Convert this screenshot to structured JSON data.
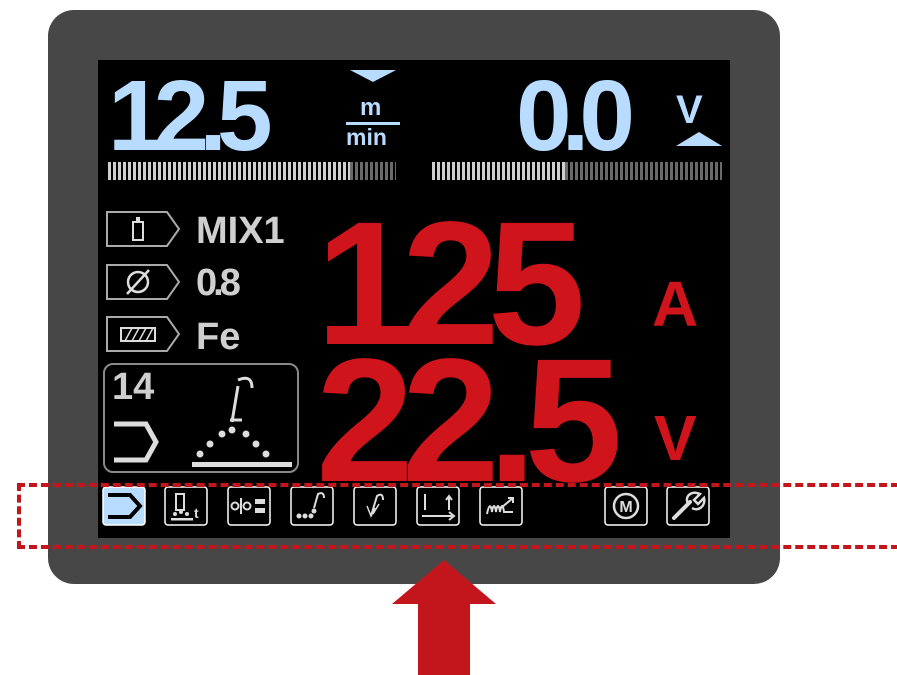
{
  "wire_speed": {
    "value": "12.5",
    "unit_top": "m",
    "unit_bottom": "min",
    "bar_level": 0.84
  },
  "arc_voltage": {
    "value": "0.0",
    "unit": "V",
    "bar_level": 0.46
  },
  "process": {
    "gas": "MIX1",
    "wire_diameter": "0.8",
    "material": "Fe",
    "program_number": "14",
    "gas_icon": "gas-cylinder-icon",
    "diameter_icon": "diameter-icon",
    "material_icon": "material-plate-icon"
  },
  "current": {
    "value": "125",
    "unit": "A"
  },
  "voltage": {
    "value": "22.5",
    "unit": "V"
  },
  "toolbar": [
    {
      "icon": "trigger-2step-icon",
      "active": true
    },
    {
      "icon": "spot-timer-icon",
      "active": false
    },
    {
      "icon": "inductance-icon",
      "active": false
    },
    {
      "icon": "run-in-icon",
      "active": false
    },
    {
      "icon": "burnback-icon",
      "active": false
    },
    {
      "icon": "crater-icon",
      "active": false
    },
    {
      "icon": "hot-start-icon",
      "active": false
    },
    {
      "icon": "memory-icon",
      "label": "M",
      "active": false
    },
    {
      "icon": "settings-wrench-icon",
      "active": false
    }
  ],
  "colors": {
    "bezel": "#474747",
    "screen": "#000000",
    "blue": "#b8dcff",
    "red": "#d0141c",
    "highlight": "#c3161c"
  }
}
